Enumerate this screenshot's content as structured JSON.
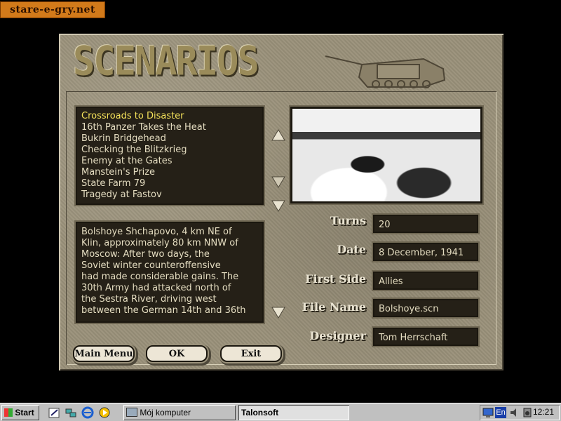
{
  "watermark": "stare-e-gry.net",
  "title": "SCENARIOS",
  "scenarios": [
    {
      "label": "Crossroads to Disaster",
      "selected": true
    },
    {
      "label": "16th Panzer Takes the Heat"
    },
    {
      "label": "Bukrin Bridgehead"
    },
    {
      "label": "Checking the Blitzkrieg"
    },
    {
      "label": "Enemy at the Gates"
    },
    {
      "label": "Manstein's Prize"
    },
    {
      "label": "State Farm 79"
    },
    {
      "label": "Tragedy at Fastov"
    }
  ],
  "description": "Bolshoye Shchapovo, 4 km NE of\nKlin, approximately 80 km NNW of\nMoscow: After two days, the\nSoviet winter counteroffensive\nhad made considerable gains. The\n30th Army had attacked north of\nthe Sestra River, driving west\nbetween the German 14th and 36th",
  "fields": {
    "turns_label": "Turns",
    "turns": "20",
    "date_label": "Date",
    "date": "8 December, 1941",
    "first_side_label": "First Side",
    "first_side": "Allies",
    "file_name_label": "File Name",
    "file_name": "Bolshoye.scn",
    "designer_label": "Designer",
    "designer": "Tom Herrschaft"
  },
  "buttons": {
    "main_menu": "Main Menu",
    "ok": "OK",
    "exit": "Exit"
  },
  "taskbar": {
    "start": "Start",
    "task1": "Mój komputer",
    "task2": "Talonsoft",
    "lang": "En",
    "clock": "12:21"
  },
  "colors": {
    "accent_selected": "#f4e25a",
    "panel": "#9a917a",
    "box": "#252017"
  }
}
